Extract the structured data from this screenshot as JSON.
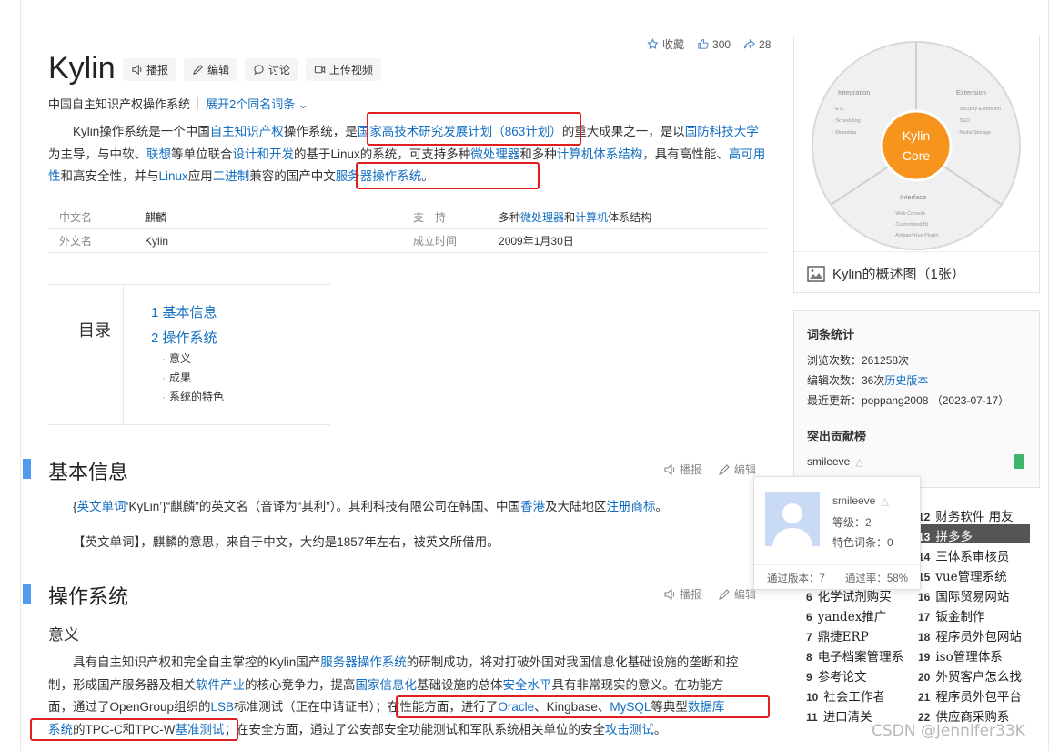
{
  "title": "Kylin",
  "toolbar": {
    "report": "播报",
    "edit": "编辑",
    "discuss": "讨论",
    "upload_video": "上传视频"
  },
  "stats_bar": {
    "collect": "收藏",
    "likes": "300",
    "shares": "28"
  },
  "subtitle": {
    "desc": "中国自主知识产权操作系统",
    "expand": "展开2个同名词条"
  },
  "summary": {
    "s1": "Kylin操作系统是一个中国",
    "l1": "自主知识产权",
    "s2": "操作系统，是",
    "l2": "国家高技术研究发展计划（863计划）",
    "s3": "的重大成果之一，是以",
    "l3": "国防科技大学",
    "s4": "为主导，与中软、",
    "l4": "联想",
    "s5": "等单位联合",
    "l5": "设计和开发",
    "s6": "的基于Linux的系统，可支持多种",
    "l6": "微处理器",
    "s7": "和多种",
    "l7": "计算机体系结构",
    "s8": "，具有高性能、",
    "l8": "高可用性",
    "s9": "和高安全性，并与",
    "l9": "Linux",
    "s10": "应用",
    "l10": "二进制",
    "s11": "兼容的国产中文",
    "l11": "服务器操作系统",
    "s12": "。"
  },
  "infobox": {
    "cn_name_k": "中文名",
    "cn_name_v": "麒麟",
    "en_name_k": "外文名",
    "en_name_v": "Kylin",
    "support_k": "支　持",
    "support_pre": "多种",
    "support_l1": "微处理器",
    "support_mid": "和",
    "support_l2": "计算机",
    "support_post": "体系结构",
    "date_k": "成立时间",
    "date_v": "2009年1月30日"
  },
  "toc": {
    "label": "目录",
    "items": [
      "1  基本信息",
      "2  操作系统"
    ],
    "subitems": [
      "意义",
      "成果",
      "系统的特色"
    ]
  },
  "section1": {
    "title": "基本信息",
    "p1_a": "{",
    "p1_l1": "英文单词",
    "p1_b": "‘KyLin’}“麒麟”的英文名（音译为“其利”）。其利科技有限公司在韩国、中国",
    "p1_l2": "香港",
    "p1_c": "及大陆地区",
    "p1_l3": "注册商标",
    "p1_d": "。",
    "p2": "【英文单词】，麒麟的意思，来自于中文，大约是1857年左右，被英文所借用。"
  },
  "section2": {
    "title": "操作系统",
    "subtitle": "意义",
    "a1": "具有自主知识产权和完全自主掌控的Kylin国产",
    "al1": "服务器操作系统",
    "a2": "的研制成功，将对打破外国对我国信息化基础设施的垄断和控",
    "b1": "制，形成国产服务器及相关",
    "bl1": "软件产业",
    "b2": "的核心竞争力，提高",
    "bl2": "国家信息化",
    "b3": "基础设施的总体",
    "bl3": "安全水平",
    "b4": "具有非常现实的意义。在功能方",
    "c1": "面，通过了OpenGroup组织的",
    "cl1": "LSB",
    "c2": "标准测试（正在申请证书）；在性能方面，进行了",
    "cl2": "Oracle",
    "c3": "、Kingbase、",
    "cl3": "MySQL",
    "c4": "等典型",
    "cl4": "数据库",
    "d1": "系统",
    "d2": "的TPC-C和TPC-W",
    "dl1": "基准测试",
    "d3": "；在安全方面，通过了公安部安全功能测试和军队系统相关单位的安全",
    "dl2": "攻击测试",
    "d4": "。"
  },
  "figure": {
    "center_line1": "Kylin",
    "center_line2": "Core",
    "integration": "Integration",
    "integration_items": [
      "ETL",
      "Scheduling",
      "Metadata"
    ],
    "extension": "Extension",
    "extension_items": [
      "Security Extension",
      "SSO",
      "Redis Storage"
    ],
    "interface": "Interface",
    "interface_items": [
      "Web Console",
      "Customized BI",
      "Ambari/ Hue Plugin"
    ],
    "caption": "Kylin的概述图（1张）"
  },
  "entry_stats": {
    "heading": "词条统计",
    "views": "浏览次数：261258次",
    "edits_pre": "编辑次数：36次",
    "edits_link": "历史版本",
    "updated": "最近更新：poppang2008 （2023-07-17）",
    "contrib_heading": "突出贡献榜",
    "contributor": "smileeve"
  },
  "popup": {
    "name": "smileeve",
    "level": "等级：2",
    "featured": "特色词条：0",
    "passed": "通过版本：7",
    "rate": "通过率：58%"
  },
  "rank_list": {
    "left": [
      {
        "n": "6",
        "t": "化学试剂购买"
      },
      {
        "n": "6",
        "t": "yandex推广"
      },
      {
        "n": "7",
        "t": "鼎捷ERP"
      },
      {
        "n": "8",
        "t": "电子档案管理系"
      },
      {
        "n": "9",
        "t": "参考论文"
      },
      {
        "n": "10",
        "t": "社会工作者"
      },
      {
        "n": "11",
        "t": "进口清关"
      }
    ],
    "right": [
      {
        "n": "12",
        "t": "财务软件 用友"
      },
      {
        "n": "13",
        "t": "拼多多"
      },
      {
        "n": "14",
        "t": "三体系审核员"
      },
      {
        "n": "15",
        "t": "vue管理系统"
      },
      {
        "n": "16",
        "t": "国际贸易网站"
      },
      {
        "n": "17",
        "t": "钣金制作"
      },
      {
        "n": "18",
        "t": "程序员外包网站"
      },
      {
        "n": "19",
        "t": "iso管理体系"
      },
      {
        "n": "20",
        "t": "外贸客户怎么找"
      },
      {
        "n": "21",
        "t": "程序员外包平台"
      },
      {
        "n": "22",
        "t": "供应商采购系"
      }
    ]
  },
  "watermark": "CSDN @Jennifer33K"
}
